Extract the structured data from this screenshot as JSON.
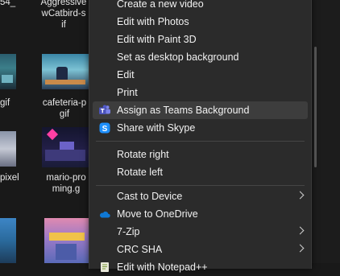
{
  "files": [
    {
      "name_lines": [
        "54_"
      ]
    },
    {
      "name_lines": [
        "Aggressive",
        "wCatbird-s",
        "if"
      ]
    },
    {
      "name_lines": [
        "gif"
      ]
    },
    {
      "name_lines": [
        "cafeteria-p",
        "gif"
      ]
    },
    {
      "name_lines": [
        "pixel"
      ]
    },
    {
      "name_lines": [
        "mario-pro",
        "ming.g"
      ]
    }
  ],
  "context_menu": {
    "items": [
      {
        "label": "Create a new video",
        "icon": "none",
        "submenu": false
      },
      {
        "label": "Edit with Photos",
        "icon": "none",
        "submenu": false
      },
      {
        "label": "Edit with Paint 3D",
        "icon": "none",
        "submenu": false
      },
      {
        "label": "Set as desktop background",
        "icon": "none",
        "submenu": false
      },
      {
        "label": "Edit",
        "icon": "none",
        "submenu": false
      },
      {
        "label": "Print",
        "icon": "none",
        "submenu": false
      },
      {
        "label": "Assign as Teams Background",
        "icon": "teams-icon",
        "submenu": false,
        "highlighted": true
      },
      {
        "label": "Share with Skype",
        "icon": "skype-icon",
        "submenu": false
      },
      {
        "label": "Rotate right",
        "icon": "none",
        "submenu": false
      },
      {
        "label": "Rotate left",
        "icon": "none",
        "submenu": false
      },
      {
        "label": "Cast to Device",
        "icon": "none",
        "submenu": true
      },
      {
        "label": "Move to OneDrive",
        "icon": "onedrive-icon",
        "submenu": false
      },
      {
        "label": "7-Zip",
        "icon": "none",
        "submenu": true
      },
      {
        "label": "CRC SHA",
        "icon": "none",
        "submenu": true
      },
      {
        "label": "Edit with Notepad++",
        "icon": "notepadpp-icon",
        "submenu": false
      }
    ]
  },
  "colors": {
    "menu_bg": "#2b2b2b",
    "hover_bg": "#3d3d3d",
    "teams": "#5059c9",
    "skype": "#1e90ff",
    "onedrive": "#0f78d4"
  }
}
